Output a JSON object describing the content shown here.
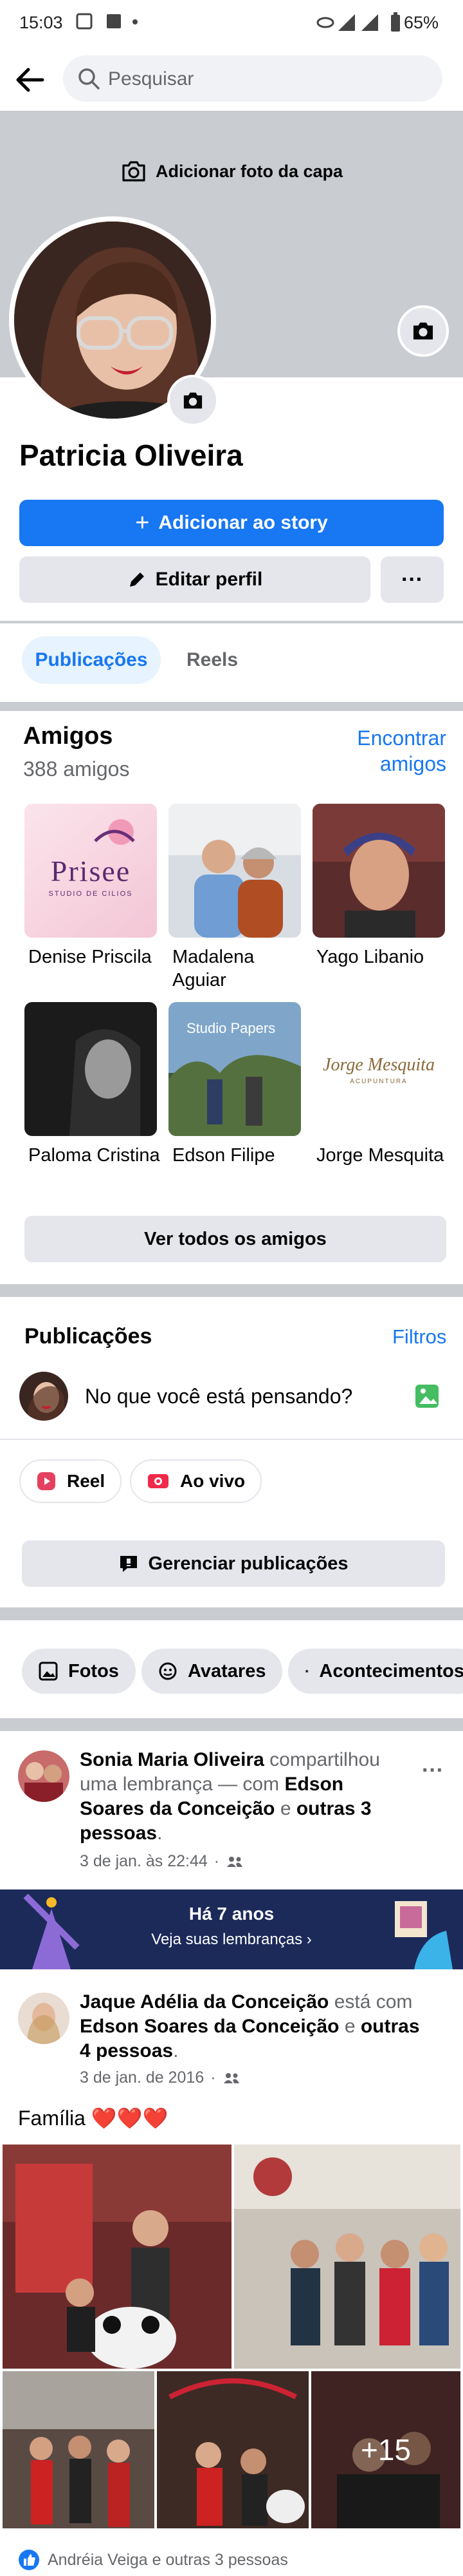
{
  "status_bar": {
    "time": "15:03",
    "battery": "65%"
  },
  "search": {
    "placeholder": "Pesquisar"
  },
  "cover": {
    "add_cover_label": "Adicionar foto da capa"
  },
  "profile": {
    "name": "Patricia Oliveira",
    "add_story_label": "Adicionar ao story",
    "edit_profile_label": "Editar perfil",
    "more_label": "···"
  },
  "tabs": [
    {
      "label": "Publicações",
      "active": true
    },
    {
      "label": "Reels",
      "active": false
    }
  ],
  "friends": {
    "title": "Amigos",
    "count": "388 amigos",
    "find_link": "Encontrar amigos",
    "see_all_label": "Ver todos os amigos",
    "items": [
      {
        "name": "Denise Priscila",
        "photo_text": "Prisee",
        "photo_subtext": "STUDIO DE CILIOS"
      },
      {
        "name": "Madalena Aguiar"
      },
      {
        "name": "Yago Libanio"
      },
      {
        "name": "Paloma Cristina"
      },
      {
        "name": "Edson Filipe",
        "photo_text": "Studio Papers"
      },
      {
        "name": "Jorge Mesquita",
        "photo_text": "Jorge Mesquita",
        "photo_subtext": "ACUPUNTURA"
      }
    ]
  },
  "publications": {
    "title": "Publicações",
    "filters_link": "Filtros",
    "composer_placeholder": "No que você está pensando?",
    "reel_label": "Reel",
    "live_label": "Ao vivo",
    "manage_label": "Gerenciar publicações"
  },
  "chips": [
    "Fotos",
    "Avatares",
    "Acontecimentos"
  ],
  "post1": {
    "author": "Sonia Maria Oliveira",
    "action": "compartilhou uma lembrança — com",
    "tagged": "Edson Soares da Conceição",
    "and": "e",
    "others": "outras 3 pessoas",
    "date": "3 de jan. às 22:44",
    "menu": "···"
  },
  "memory": {
    "title": "Há 7 anos",
    "link": "Veja suas lembranças"
  },
  "post2": {
    "author": "Jaque Adélia da Conceição",
    "action": "está com",
    "tagged": "Edson Soares da Conceição",
    "and": "e",
    "others": "outras 4 pessoas",
    "date": "3 de jan. de 2016",
    "caption": "Família ❤️❤️❤️",
    "more_photos": "+15",
    "reactions": "Andréia Veiga e outras 3 pessoas"
  },
  "colors": {
    "accent": "#1877f2",
    "divider": "#c9ccd1",
    "memory_bg": "#1c2a5a"
  }
}
